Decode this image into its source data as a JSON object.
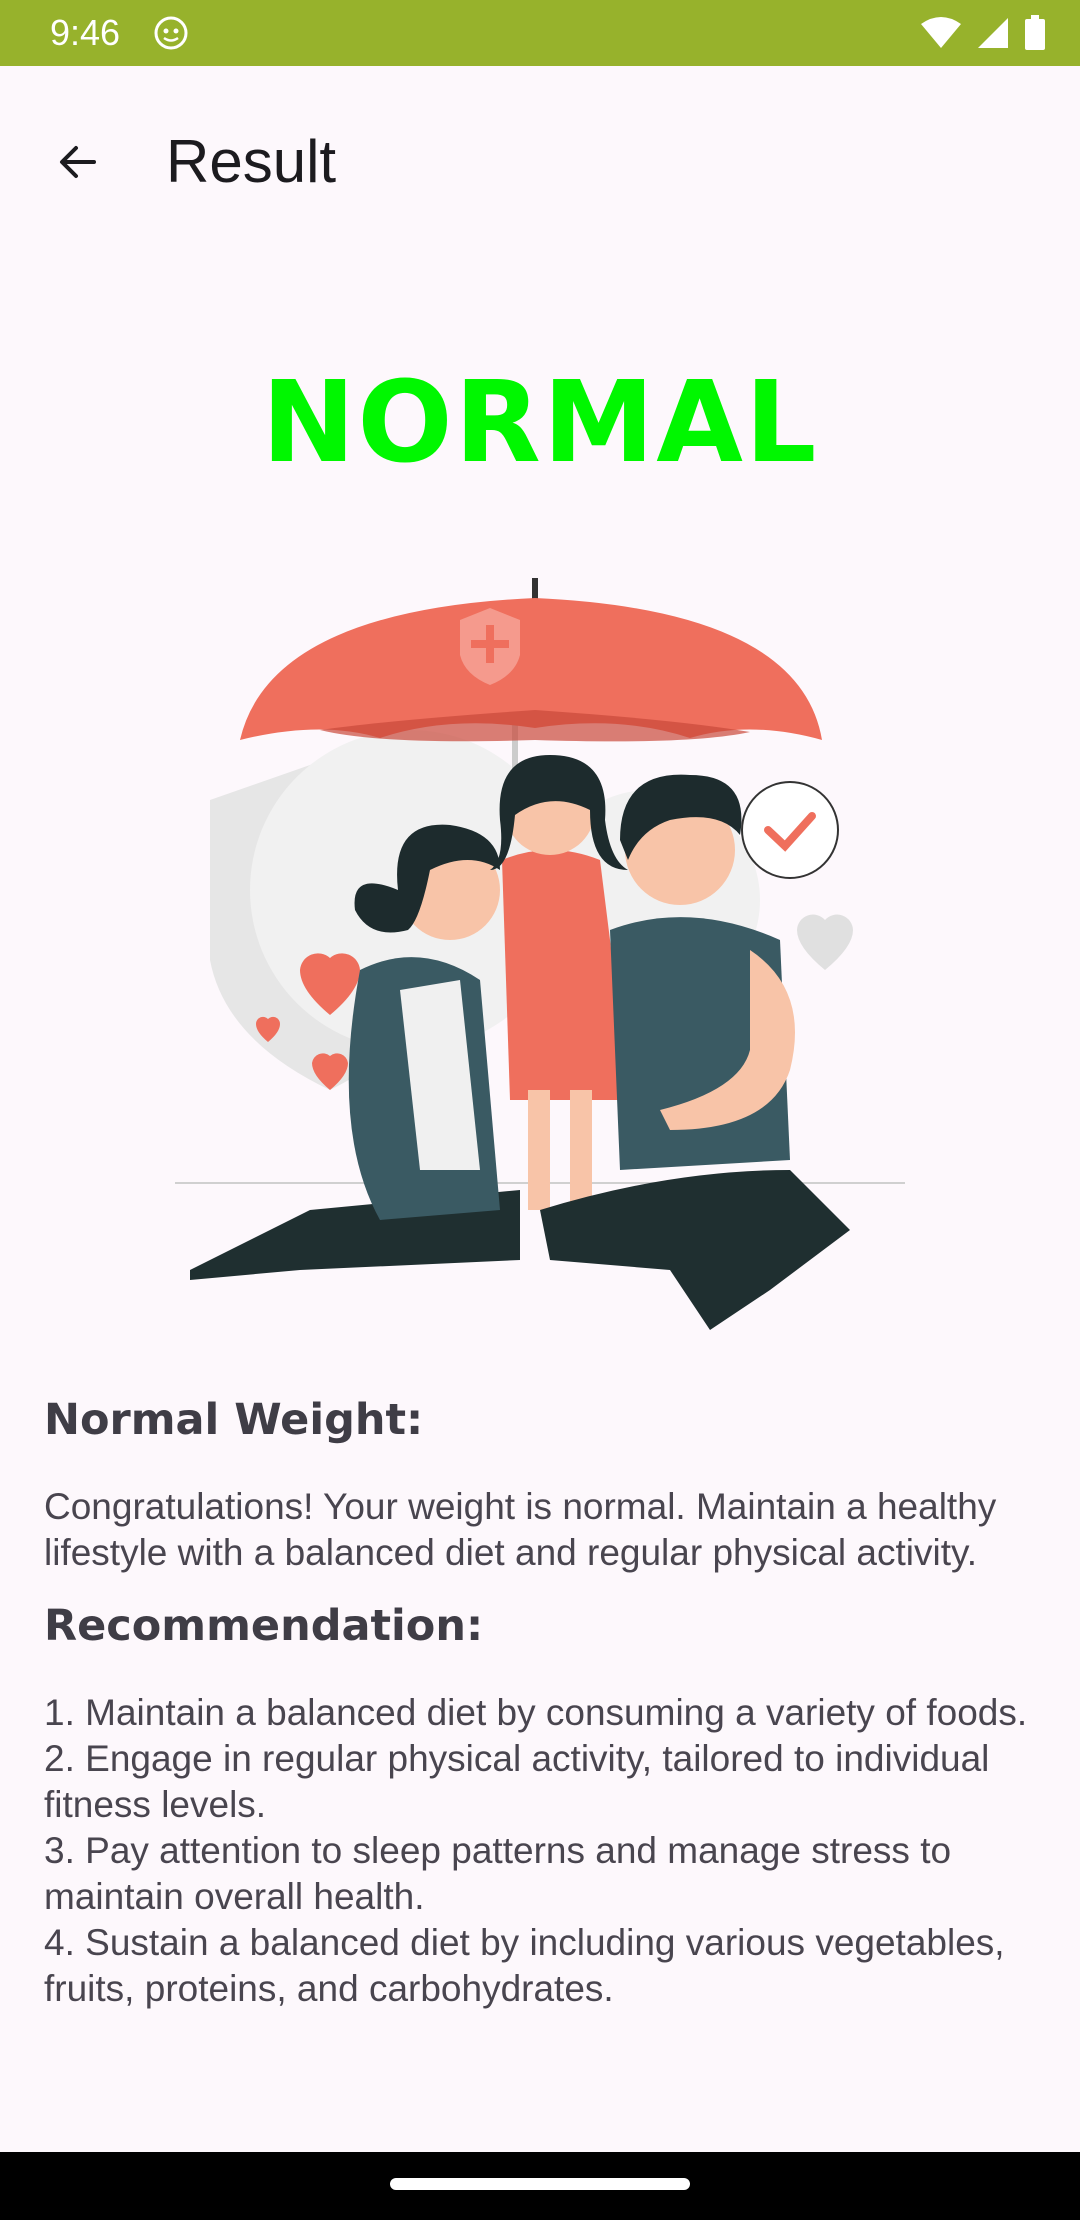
{
  "status_bar": {
    "time": "9:46",
    "background": "#97b22c"
  },
  "app_bar": {
    "title": "Result",
    "back_icon": "arrow-back-icon"
  },
  "result": {
    "category": "NORMAL",
    "color": "#00f700"
  },
  "illustration": {
    "icon": "family-under-umbrella-illustration"
  },
  "sections": {
    "description_title": "Normal Weight:",
    "description_body": "Congratulations! Your weight is normal. Maintain a healthy lifestyle with a balanced diet and regular physical activity.",
    "recommendation_title": "Recommendation:",
    "recommendation_body": "1. Maintain a balanced diet by consuming a variety of foods.\n 2. Engage in regular physical activity, tailored to individual fitness levels.\n 3. Pay attention to sleep patterns and manage stress to maintain overall health.\n 4. Sustain a balanced diet by including various vegetables, fruits, proteins, and carbohydrates."
  }
}
